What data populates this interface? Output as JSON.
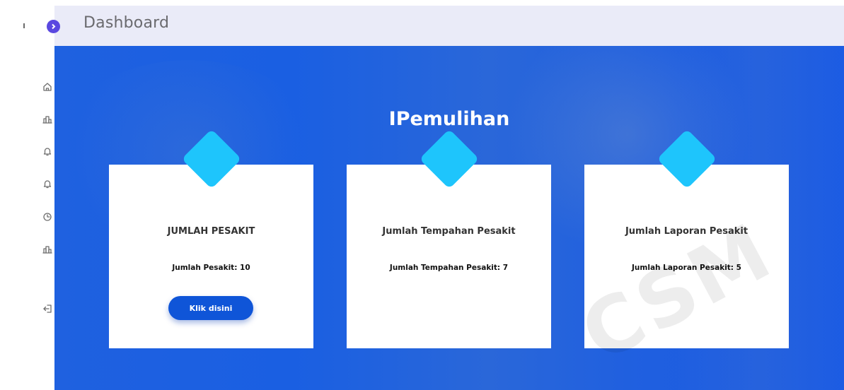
{
  "header": {
    "title": "Dashboard"
  },
  "sidebar": {
    "items": [
      {
        "icon": "home-icon"
      },
      {
        "icon": "chart-icon"
      },
      {
        "icon": "bell-icon"
      },
      {
        "icon": "bell-icon"
      },
      {
        "icon": "clock-icon"
      },
      {
        "icon": "chart-icon"
      },
      {
        "icon": "logout-icon"
      }
    ]
  },
  "hero": {
    "title": "IPemulihan"
  },
  "cards": [
    {
      "title": "JUMLAH PESAKIT",
      "text": "Jumlah Pesakit: 10",
      "button": "Klik disini"
    },
    {
      "title": "Jumlah Tempahan Pesakit",
      "text": "Jumlah Tempahan Pesakit: 7"
    },
    {
      "title": "Jumlah Laporan Pesakit",
      "text": "Jumlah Laporan Pesakit: 5"
    }
  ],
  "watermark": "CSM",
  "colors": {
    "accent": "#1a5fe2",
    "diamond": "#1ec5fc",
    "topbar": "#eaebf8",
    "toggle": "#5a48e0",
    "button": "#0f55d8"
  }
}
